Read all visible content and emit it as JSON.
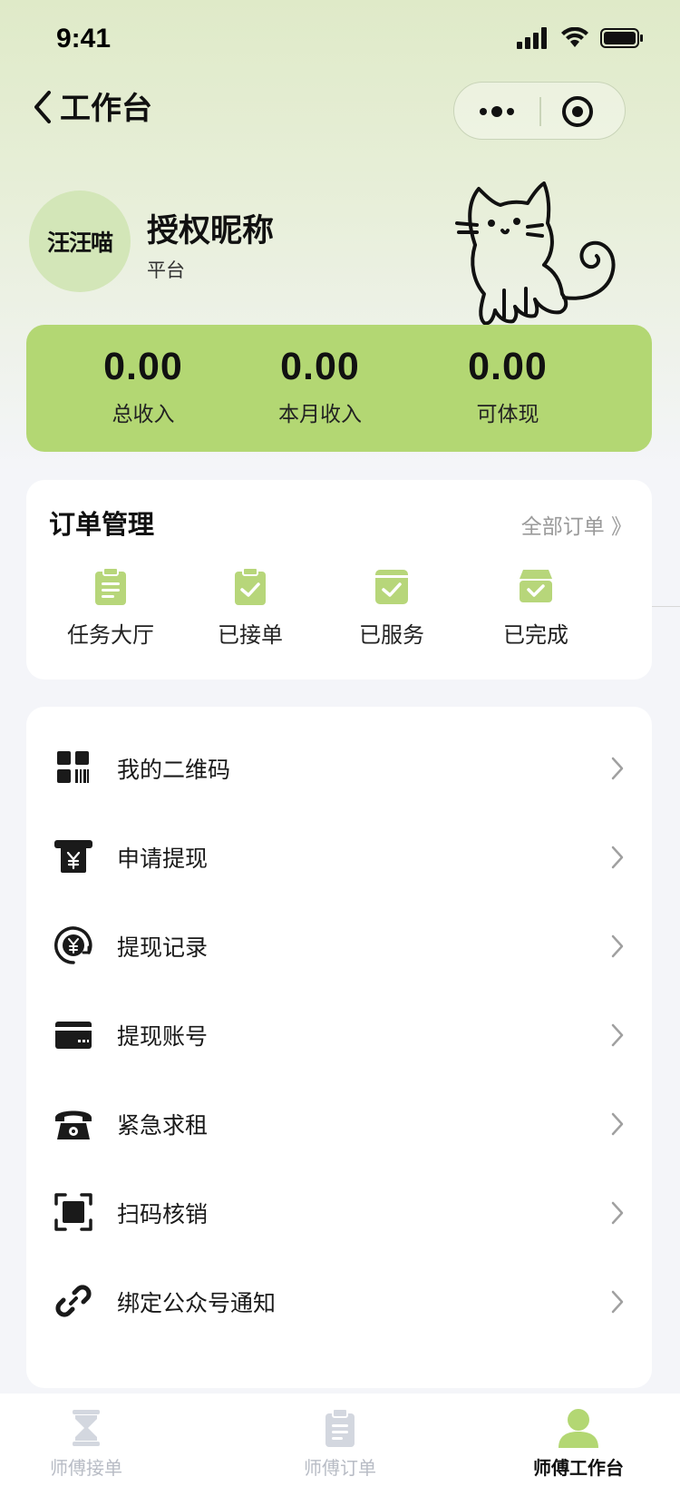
{
  "status_bar": {
    "time": "9:41"
  },
  "nav": {
    "title": "工作台"
  },
  "profile": {
    "avatar_text": "汪汪喵",
    "nickname": "授权昵称",
    "role": "平台"
  },
  "stats": [
    {
      "value": "0.00",
      "label": "总收入"
    },
    {
      "value": "0.00",
      "label": "本月收入"
    },
    {
      "value": "0.00",
      "label": "可体现"
    }
  ],
  "orders": {
    "title": "订单管理",
    "all_link": "全部订单 》",
    "items": [
      {
        "label": "任务大厅",
        "icon": "clipboard-icon"
      },
      {
        "label": "已接单",
        "icon": "clipboard-check-icon"
      },
      {
        "label": "已服务",
        "icon": "calendar-check-icon"
      },
      {
        "label": "已完成",
        "icon": "box-check-icon"
      }
    ]
  },
  "menu": [
    {
      "label": "我的二维码",
      "icon": "qrcode-icon"
    },
    {
      "label": "申请提现",
      "icon": "atm-yen-icon"
    },
    {
      "label": "提现记录",
      "icon": "yen-history-icon"
    },
    {
      "label": "提现账号",
      "icon": "card-icon"
    },
    {
      "label": "紧急求租",
      "icon": "phone-icon"
    },
    {
      "label": "扫码核销",
      "icon": "scan-icon"
    },
    {
      "label": "绑定公众号通知",
      "icon": "link-icon"
    }
  ],
  "tabbar": {
    "tabs": [
      {
        "label": "师傅接单",
        "icon": "hourglass-icon",
        "active": false
      },
      {
        "label": "师傅订单",
        "icon": "clipboard-icon",
        "active": false
      },
      {
        "label": "师傅工作台",
        "icon": "user-icon",
        "active": true
      }
    ]
  },
  "colors": {
    "accent": "#b3d773",
    "icon_green": "#b7d67a",
    "text": "#1a1a1a",
    "muted": "#9a9a9a",
    "tab_inactive": "#b8bcc5"
  }
}
